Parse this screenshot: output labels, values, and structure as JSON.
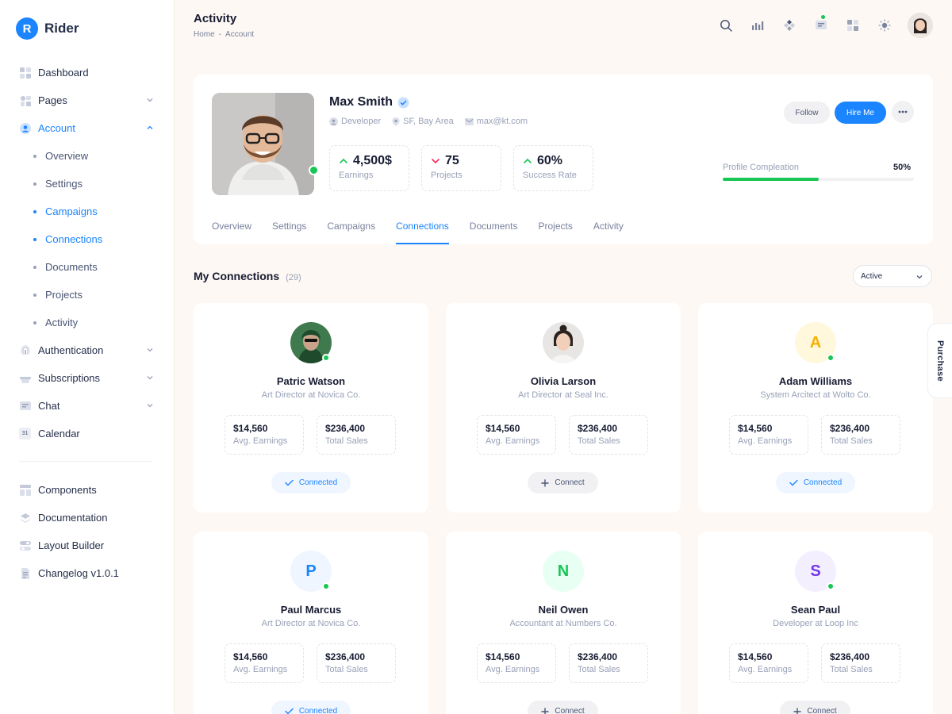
{
  "app": {
    "logo_letter": "R",
    "name": "Rider"
  },
  "sidebar": {
    "items": [
      {
        "id": "dashboard",
        "label": "Dashboard",
        "icon": "dashboard-icon"
      },
      {
        "id": "pages",
        "label": "Pages",
        "icon": "pages-icon",
        "expandable": true
      },
      {
        "id": "account",
        "label": "Account",
        "icon": "account-icon",
        "expandable": true,
        "expanded": true,
        "active": true
      }
    ],
    "account_sub": [
      {
        "label": "Overview",
        "active": false
      },
      {
        "label": "Settings",
        "active": false
      },
      {
        "label": "Campaigns",
        "active": true
      },
      {
        "label": "Connections",
        "active": true
      },
      {
        "label": "Documents",
        "active": false
      },
      {
        "label": "Projects",
        "active": false
      },
      {
        "label": "Activity",
        "active": false
      }
    ],
    "items_after": [
      {
        "id": "authentication",
        "label": "Authentication",
        "icon": "fingerprint-icon",
        "expandable": true
      },
      {
        "id": "subscriptions",
        "label": "Subscriptions",
        "icon": "basket-icon",
        "expandable": true
      },
      {
        "id": "chat",
        "label": "Chat",
        "icon": "chat-icon",
        "expandable": true
      },
      {
        "id": "calendar",
        "label": "Calendar",
        "icon": "calendar-icon",
        "calendar_day": "31"
      }
    ],
    "bottom": [
      {
        "id": "components",
        "label": "Components",
        "icon": "components-icon"
      },
      {
        "id": "documentation",
        "label": "Documentation",
        "icon": "layers-icon"
      },
      {
        "id": "layout-builder",
        "label": "Layout Builder",
        "icon": "toggle-icon"
      },
      {
        "id": "changelog",
        "label": "Changelog v1.0.1",
        "icon": "document-icon"
      }
    ]
  },
  "header": {
    "title": "Activity",
    "breadcrumb": [
      "Home",
      "-",
      "Account"
    ]
  },
  "profile": {
    "name": "Max Smith",
    "role": "Developer",
    "location": "SF, Bay Area",
    "email": "max@kt.com",
    "stats": [
      {
        "value": "4,500$",
        "label": "Earnings",
        "trend": "up"
      },
      {
        "value": "75",
        "label": "Projects",
        "trend": "down"
      },
      {
        "value": "60%",
        "label": "Success Rate",
        "trend": "up"
      }
    ],
    "follow_label": "Follow",
    "hire_label": "Hire Me",
    "progress_label": "Profile Compleation",
    "progress_text": "50%",
    "progress_value": 0.5
  },
  "tabs": [
    {
      "label": "Overview",
      "active": false
    },
    {
      "label": "Settings",
      "active": false
    },
    {
      "label": "Campaigns",
      "active": false
    },
    {
      "label": "Connections",
      "active": true
    },
    {
      "label": "Documents",
      "active": false
    },
    {
      "label": "Projects",
      "active": false
    },
    {
      "label": "Activity",
      "active": false
    }
  ],
  "connections": {
    "title": "My Connections",
    "count": "(29)",
    "filter_value": "Active",
    "purchase_label": "Purchase",
    "stat_labels": {
      "earnings": "Avg. Earnings",
      "sales": "Total Sales"
    },
    "cards": [
      {
        "name": "Patric Watson",
        "role": "Art Director at Novica Co.",
        "earnings": "$14,560",
        "sales": "$236,400",
        "status": "Connected",
        "avatar_type": "photo",
        "online": true
      },
      {
        "name": "Olivia Larson",
        "role": "Art Director at Seal Inc.",
        "earnings": "$14,560",
        "sales": "$236,400",
        "status": "Connect",
        "avatar_type": "photo",
        "online": false
      },
      {
        "name": "Adam Williams",
        "role": "System Arcitect at Wolto Co.",
        "earnings": "$14,560",
        "sales": "$236,400",
        "status": "Connected",
        "avatar_type": "letter",
        "letter": "A",
        "bg": "#fff8dd",
        "fg": "#f6b100",
        "online": true
      },
      {
        "name": "Paul Marcus",
        "role": "Art Director at Novica Co.",
        "earnings": "$14,560",
        "sales": "$236,400",
        "status": "Connected",
        "avatar_type": "letter",
        "letter": "P",
        "bg": "#eff6ff",
        "fg": "#1b84ff",
        "online": true
      },
      {
        "name": "Neil Owen",
        "role": "Accountant at Numbers Co.",
        "earnings": "$14,560",
        "sales": "$236,400",
        "status": "Connect",
        "avatar_type": "letter",
        "letter": "N",
        "bg": "#e8fff3",
        "fg": "#17c653",
        "online": false
      },
      {
        "name": "Sean Paul",
        "role": "Developer at Loop Inc",
        "earnings": "$14,560",
        "sales": "$236,400",
        "status": "Connect",
        "avatar_type": "letter",
        "letter": "S",
        "bg": "#f4efff",
        "fg": "#7239ea",
        "online": true
      }
    ]
  },
  "colors": {
    "primary": "#1b84ff",
    "success": "#17c653",
    "danger": "#f8285a",
    "bg": "#fdf8f3"
  }
}
